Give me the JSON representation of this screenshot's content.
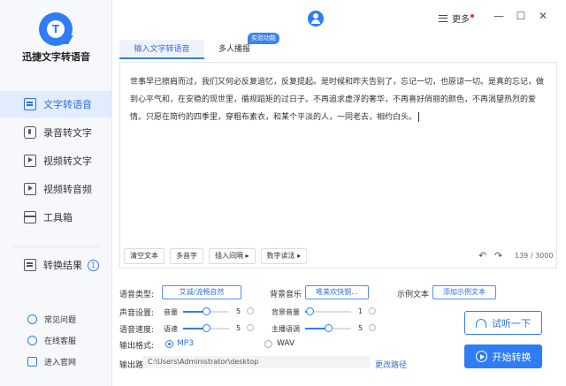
{
  "app": {
    "name": "迅捷文字转语音"
  },
  "sidebar": {
    "items": [
      {
        "label": "文字转语音"
      },
      {
        "label": "录音转文字"
      },
      {
        "label": "视频转文字"
      },
      {
        "label": "视频转音频"
      },
      {
        "label": "工具箱"
      }
    ],
    "results": {
      "label": "转换结果",
      "count": "1"
    },
    "footer": [
      {
        "label": "常见问题"
      },
      {
        "label": "在线客服"
      },
      {
        "label": "进入官网"
      }
    ]
  },
  "topbar": {
    "more_label": "更多"
  },
  "tabs": [
    {
      "label": "输入文字转语音"
    },
    {
      "label": "多人播报"
    }
  ],
  "feature_badge": "实验功能",
  "editor": {
    "text": "世事早已擦肩而过，我们又何必反复追忆，反复提起。是时候和昨天告别了，忘记一切，也原谅一切。是真的忘记，做到心平气和，在安稳的现世里，循规蹈矩的过日子。不再追求虚浮的奢华，不再喜好俏丽的颜色，不再渴望热烈的爱情。只愿在简约的四季里，穿粗布素衣，和某个平淡的人，一同老去，相约白头。",
    "counter": "139 / 3000",
    "buttons": [
      "清空文本",
      "多音字",
      "插入间隔 ▸",
      "数字读法 ▸"
    ]
  },
  "settings": {
    "voice_type_label": "语音类型:",
    "voice_type_value": "艾诚/流畅自然",
    "bg_music_label": "背景音乐",
    "bg_music_value": "唯美欢快钢...",
    "sample_text_label": "示例文本",
    "sample_text_button": "添加示例文本",
    "voice_settings_label": "声音设置:",
    "voice_speed_label": "语音速度:",
    "volume": {
      "label": "音量",
      "value": 5,
      "min": 0,
      "max": 10
    },
    "speed": {
      "label": "语速",
      "value": 5,
      "min": 0,
      "max": 10
    },
    "bg_volume": {
      "label": "背景音量",
      "value": 1,
      "min": 0,
      "max": 10
    },
    "host_tone": {
      "label": "主播语调",
      "value": 5,
      "min": 0,
      "max": 10
    },
    "output_format_label": "输出格式:",
    "formats": [
      {
        "label": "MP3",
        "selected": true
      },
      {
        "label": "WAV",
        "selected": false
      }
    ],
    "output_path_label": "输出路径:",
    "output_path": "C:\\Users\\Administrator\\desktop",
    "change_path": "更改路径"
  },
  "actions": {
    "preview": "试听一下",
    "start": "开始转换"
  },
  "colors": {
    "accent": "#2f7df6",
    "sidebar_bg": "#f6f8fc",
    "active_bg": "#e1ecfd"
  }
}
